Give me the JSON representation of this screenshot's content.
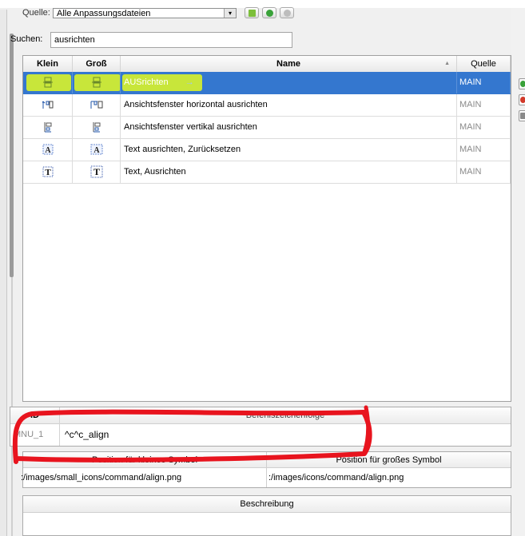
{
  "source": {
    "label": "Quelle:",
    "selected": "Alle Anpassungsdateien"
  },
  "search": {
    "label": "Suchen:",
    "value": "ausrichten"
  },
  "grid": {
    "headers": {
      "small": "Klein",
      "large": "Groß",
      "name": "Name",
      "source": "Quelle"
    },
    "rows": [
      {
        "name": "AUSrichten",
        "source": "MAIN",
        "selected": true
      },
      {
        "name": "Ansichtsfenster horizontal ausrichten",
        "source": "MAIN",
        "selected": false
      },
      {
        "name": "Ansichtsfenster vertikal ausrichten",
        "source": "MAIN",
        "selected": false
      },
      {
        "name": "Text ausrichten, Zurücksetzen",
        "source": "MAIN",
        "selected": false
      },
      {
        "name": "Text, Ausrichten",
        "source": "MAIN",
        "selected": false
      }
    ]
  },
  "id_table": {
    "id_header": "ID",
    "shortcut_header": "Befehlszeichenfolge",
    "id_value": "MNU_1",
    "shortcut_value": "^c^c_align"
  },
  "position": {
    "small_header": "Position für kleines Symbol",
    "large_header": "Position für großes Symbol",
    "small_value": ":/images/small_icons/command/align.png",
    "large_value": ":/images/icons/command/align.png"
  },
  "description": {
    "header": "Beschreibung"
  },
  "colors": {
    "selection": "#3477cf",
    "highlight": "#c8e63a",
    "annotation": "#e8141e"
  }
}
